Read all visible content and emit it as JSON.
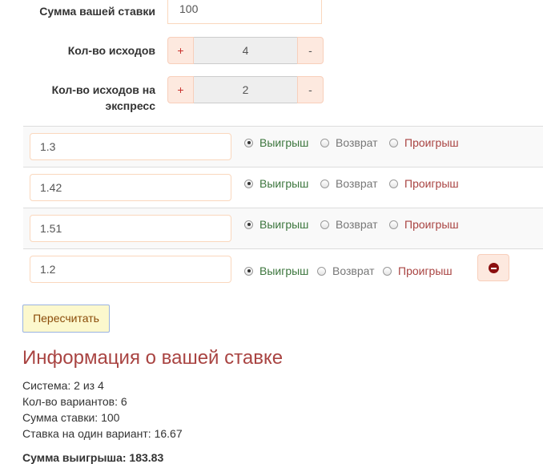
{
  "form": {
    "stake_label": "Сумма вашей ставки",
    "stake_value": "100",
    "outcomes_label": "Кол-во исходов",
    "outcomes_value": "4",
    "express_label_line1": "Кол-во исходов на",
    "express_label_line2": "экспресс",
    "express_value": "2",
    "plus": "+",
    "minus": "-"
  },
  "radio_labels": {
    "win": "Выигрыш",
    "return": "Возврат",
    "loss": "Проигрыш"
  },
  "odds": [
    {
      "value": "1.3",
      "selected": "win"
    },
    {
      "value": "1.42",
      "selected": "win"
    },
    {
      "value": "1.51",
      "selected": "win"
    },
    {
      "value": "1.2",
      "selected": "win"
    }
  ],
  "recalc_label": "Пересчитать",
  "info": {
    "title": "Информация о вашей ставке",
    "system": "Система: 2 из 4",
    "variants": "Кол-во вариантов: 6",
    "stake_sum": "Сумма ставки: 100",
    "per_variant": "Ставка на один вариант: 16.67",
    "win_sum": "Сумма выигрыша: 183.83"
  },
  "icons": {
    "remove": "minus-circle-icon"
  },
  "colors": {
    "win": "#3c763d",
    "return": "#777777",
    "loss": "#a94442",
    "title": "#a94442"
  }
}
